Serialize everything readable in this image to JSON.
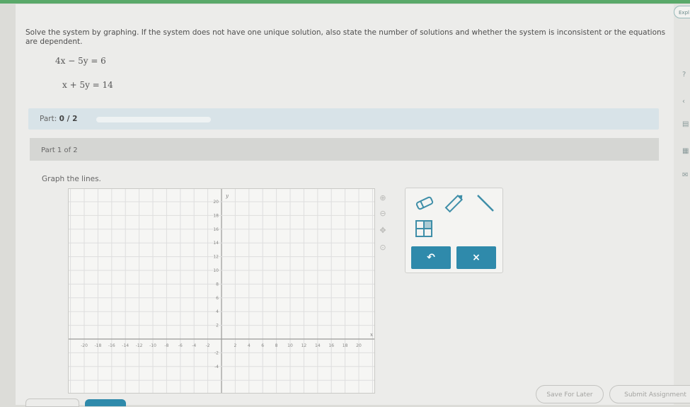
{
  "question": {
    "prompt": "Solve the system by graphing. If the system does not have one unique solution, also state the number of solutions and whether the system is inconsistent or the equations are dependent.",
    "equation_1": "4x − 5y = 6",
    "equation_2": "x + 5y = 14"
  },
  "progress": {
    "label": "Part:",
    "value": "0 / 2",
    "fraction": 0.0
  },
  "part_header": "Part 1 of 2",
  "instructions": "Graph the lines.",
  "graph": {
    "y_axis_label": "y",
    "x_axis_label": "x",
    "x_ticks": [
      "-20",
      "-18",
      "-16",
      "-14",
      "-12",
      "-10",
      "-8",
      "-6",
      "-4",
      "-2",
      "2",
      "4",
      "6",
      "8",
      "10",
      "12",
      "14",
      "16",
      "18",
      "20"
    ],
    "y_ticks": [
      "20",
      "18",
      "16",
      "14",
      "12",
      "10",
      "8",
      "6",
      "4",
      "2",
      "-2",
      "-4"
    ]
  },
  "tools": {
    "eraser": "eraser-icon",
    "pencil": "pencil-icon",
    "line": "line-tool-icon",
    "grid": "grid-icon",
    "undo": "undo-icon",
    "clear_label": "×"
  },
  "footer": {
    "save_label": "Save For Later",
    "submit_label": "Submit Assignment"
  },
  "rail": {
    "tab_label": "Expl"
  },
  "colors": {
    "accent": "#2f8aab",
    "top_bar": "#5aa96a",
    "progress_bg": "#d8e3e8"
  }
}
